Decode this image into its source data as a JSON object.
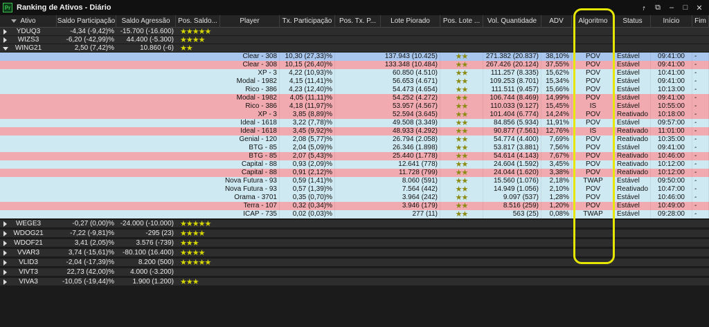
{
  "app": {
    "logo": "Pr",
    "title": "Ranking de Ativos - Diário"
  },
  "window_controls": [
    "share-icon",
    "popout-icon",
    "minimize-icon",
    "maximize-icon",
    "close-icon"
  ],
  "colors": {
    "stars": "#d4d400",
    "row_blue": "#cfe9f2",
    "row_red": "#f1aaaf",
    "row_selected": "#a9c7ee",
    "highlight": "#e6e600"
  },
  "columns": [
    "Ativo",
    "Saldo Participação",
    "Saldo Agressão",
    "Pos. Saldo...",
    "Player",
    "Tx. Participação",
    "Pos. Tx. P...",
    "Lote Piorado",
    "Pos. Lote ...",
    "Vol. Quantidade",
    "ADV",
    "Algoritmo",
    "Status",
    "Início",
    "Fim"
  ],
  "top_rows": [
    {
      "ativo": "YDUQ3",
      "saldo_part": "-4,34 (-9,42)%",
      "saldo_agr": "-15.700 (-16.600)",
      "stars": "★★★★★"
    },
    {
      "ativo": "WIZS3",
      "saldo_part": "-6,20 (-42,99)%",
      "saldo_agr": "44.400 (-5.300)",
      "stars": "★★★★"
    },
    {
      "ativo": "WING21",
      "saldo_part": "2,50 (7,42)%",
      "saldo_agr": "10.860 (-6)",
      "stars": "★★"
    }
  ],
  "child_rows": [
    {
      "player": "Clear - 308",
      "tx": "10,30 (27,33)%",
      "lote": "137.943 (10.425)",
      "stars": "★★",
      "vol": "271.382 (20.837)",
      "adv": "38,10%",
      "algo": "POV",
      "status": "Estável",
      "inicio": "09:41:00",
      "fim": "-"
    },
    {
      "player": "Clear - 308",
      "tx": "10,15 (26,40)%",
      "lote": "133.348 (10.484)",
      "stars": "★★",
      "vol": "267.426 (20.124)",
      "adv": "37,55%",
      "algo": "POV",
      "status": "Estável",
      "inicio": "09:41:00",
      "fim": "-"
    },
    {
      "player": "XP - 3",
      "tx": "4,22 (10,93)%",
      "lote": "60.850 (4.510)",
      "stars": "★★",
      "vol": "111.257 (8.335)",
      "adv": "15,62%",
      "algo": "POV",
      "status": "Estável",
      "inicio": "10:41:00",
      "fim": "-"
    },
    {
      "player": "Modal - 1982",
      "tx": "4,15 (11,41)%",
      "lote": "56.653 (4.671)",
      "stars": "★★",
      "vol": "109.253 (8.701)",
      "adv": "15,34%",
      "algo": "POV",
      "status": "Estável",
      "inicio": "09:41:00",
      "fim": "-"
    },
    {
      "player": "Rico - 386",
      "tx": "4,23 (12,40)%",
      "lote": "54.473 (4.654)",
      "stars": "★★",
      "vol": "111.511 (9.457)",
      "adv": "15,66%",
      "algo": "POV",
      "status": "Estável",
      "inicio": "10:13:00",
      "fim": "-"
    },
    {
      "player": "Modal - 1982",
      "tx": "4,05 (11,11)%",
      "lote": "54.252 (4.272)",
      "stars": "★★",
      "vol": "106.744 (8.469)",
      "adv": "14,99%",
      "algo": "POV",
      "status": "Estável",
      "inicio": "09:41:00",
      "fim": "-"
    },
    {
      "player": "Rico - 386",
      "tx": "4,18 (11,97)%",
      "lote": "53.957 (4.567)",
      "stars": "★★",
      "vol": "110.033 (9.127)",
      "adv": "15,45%",
      "algo": "IS",
      "status": "Estável",
      "inicio": "10:55:00",
      "fim": "-"
    },
    {
      "player": "XP - 3",
      "tx": "3,85 (8,89)%",
      "lote": "52.594 (3.645)",
      "stars": "★★",
      "vol": "101.404 (6.774)",
      "adv": "14,24%",
      "algo": "POV",
      "status": "Reativado",
      "inicio": "10:18:00",
      "fim": "-"
    },
    {
      "player": "Ideal - 1618",
      "tx": "3,22 (7,78)%",
      "lote": "49.508 (3.349)",
      "stars": "★★",
      "vol": "84.856 (5.934)",
      "adv": "11,91%",
      "algo": "POV",
      "status": "Estável",
      "inicio": "09:57:00",
      "fim": "-"
    },
    {
      "player": "Ideal - 1618",
      "tx": "3,45 (9,92)%",
      "lote": "48.933 (4.292)",
      "stars": "★★",
      "vol": "90.877 (7.561)",
      "adv": "12,76%",
      "algo": "IS",
      "status": "Reativado",
      "inicio": "11:01:00",
      "fim": "-"
    },
    {
      "player": "Genial - 120",
      "tx": "2,08 (5,77)%",
      "lote": "26.794 (2.058)",
      "stars": "★★",
      "vol": "54.774 (4.400)",
      "adv": "7,69%",
      "algo": "POV",
      "status": "Reativado",
      "inicio": "10:35:00",
      "fim": "-"
    },
    {
      "player": "BTG - 85",
      "tx": "2,04 (5,09)%",
      "lote": "26.346 (1.898)",
      "stars": "★★",
      "vol": "53.817 (3.881)",
      "adv": "7,56%",
      "algo": "POV",
      "status": "Estável",
      "inicio": "09:41:00",
      "fim": "-"
    },
    {
      "player": "BTG - 85",
      "tx": "2,07 (5,43)%",
      "lote": "25.440 (1.778)",
      "stars": "★★",
      "vol": "54.614 (4.143)",
      "adv": "7,67%",
      "algo": "POV",
      "status": "Reativado",
      "inicio": "10:46:00",
      "fim": "-"
    },
    {
      "player": "Capital - 88",
      "tx": "0,93 (2,09)%",
      "lote": "12.641 (778)",
      "stars": "★★",
      "vol": "24.604 (1.592)",
      "adv": "3,45%",
      "algo": "POV",
      "status": "Reativado",
      "inicio": "10:12:00",
      "fim": "-"
    },
    {
      "player": "Capital - 88",
      "tx": "0,91 (2,12)%",
      "lote": "11.728 (799)",
      "stars": "★★",
      "vol": "24.044 (1.620)",
      "adv": "3,38%",
      "algo": "POV",
      "status": "Reativado",
      "inicio": "10:12:00",
      "fim": "-"
    },
    {
      "player": "Nova Futura - 93",
      "tx": "0,59 (1,41)%",
      "lote": "8.060 (591)",
      "stars": "★★",
      "vol": "15.560 (1.076)",
      "adv": "2,18%",
      "algo": "TWAP",
      "status": "Estável",
      "inicio": "09:50:00",
      "fim": "-"
    },
    {
      "player": "Nova Futura - 93",
      "tx": "0,57 (1,39)%",
      "lote": "7.564 (442)",
      "stars": "★★",
      "vol": "14.949 (1.056)",
      "adv": "2,10%",
      "algo": "POV",
      "status": "Reativado",
      "inicio": "10:47:00",
      "fim": "-"
    },
    {
      "player": "Orama - 3701",
      "tx": "0,35 (0,70)%",
      "lote": "3.964 (242)",
      "stars": "★★",
      "vol": "9.097 (537)",
      "adv": "1,28%",
      "algo": "POV",
      "status": "Estável",
      "inicio": "10:46:00",
      "fim": "-"
    },
    {
      "player": "Terra - 107",
      "tx": "0,32 (0,34)%",
      "lote": "3.946 (179)",
      "stars": "★★",
      "vol": "8.516 (259)",
      "adv": "1,20%",
      "algo": "POV",
      "status": "Estável",
      "inicio": "10:49:00",
      "fim": "-"
    },
    {
      "player": "ICAP - 735",
      "tx": "0,02 (0,03)%",
      "lote": "277 (11)",
      "stars": "★★",
      "vol": "563 (25)",
      "adv": "0,08%",
      "algo": "TWAP",
      "status": "Estável",
      "inicio": "09:28:00",
      "fim": "-"
    }
  ],
  "bottom_rows": [
    {
      "ativo": "WEGE3",
      "saldo_part": "-0,27 (0,00)%",
      "saldo_agr": "-24.000 (-10.000)",
      "stars": "★★★★★"
    },
    {
      "ativo": "WDOG21",
      "saldo_part": "-7,22 (-9,81)%",
      "saldo_agr": "-295 (23)",
      "stars": "★★★★"
    },
    {
      "ativo": "WDOF21",
      "saldo_part": "3,41 (2,05)%",
      "saldo_agr": "3.576 (-739)",
      "stars": "★★★"
    },
    {
      "ativo": "VVAR3",
      "saldo_part": "3,74 (-15,61)%",
      "saldo_agr": "-80.100 (16.400)",
      "stars": "★★★★"
    },
    {
      "ativo": "VLID3",
      "saldo_part": "-2,04 (-17,39)%",
      "saldo_agr": "8.200 (500)",
      "stars": "★★★★★"
    },
    {
      "ativo": "VIVT3",
      "saldo_part": "22,73 (42,00)%",
      "saldo_agr": "4.000 (-3.200)",
      "stars": ""
    },
    {
      "ativo": "VIVA3",
      "saldo_part": "-10,05 (-19,44)%",
      "saldo_agr": "1.900 (1.200)",
      "stars": "★★★"
    }
  ]
}
